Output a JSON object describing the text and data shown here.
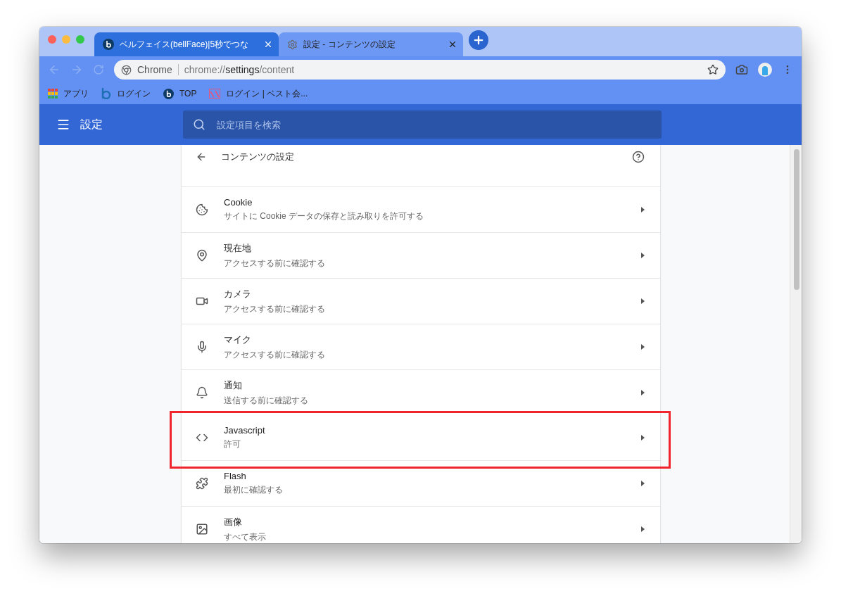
{
  "tabs": [
    {
      "title": "ベルフェイス(bellFace)|5秒でつな",
      "selected": false
    },
    {
      "title": "設定 - コンテンツの設定",
      "selected": true
    }
  ],
  "address_bar": {
    "origin_label": "Chrome",
    "url_prefix": "chrome://",
    "url_host": "settings",
    "url_path": "/content"
  },
  "bookmarks": [
    {
      "label": "アプリ"
    },
    {
      "label": "ログイン"
    },
    {
      "label": "TOP"
    },
    {
      "label": "ログイン | ベスト会..."
    }
  ],
  "header": {
    "title": "設定",
    "search_placeholder": "設定項目を検索"
  },
  "page": {
    "title": "コンテンツの設定"
  },
  "items": [
    {
      "title": "Cookie",
      "subtitle": "サイトに Cookie データの保存と読み取りを許可する",
      "highlighted": false
    },
    {
      "title": "現在地",
      "subtitle": "アクセスする前に確認する",
      "highlighted": false
    },
    {
      "title": "カメラ",
      "subtitle": "アクセスする前に確認する",
      "highlighted": false
    },
    {
      "title": "マイク",
      "subtitle": "アクセスする前に確認する",
      "highlighted": false
    },
    {
      "title": "通知",
      "subtitle": "送信する前に確認する",
      "highlighted": false
    },
    {
      "title": "Javascript",
      "subtitle": "許可",
      "highlighted": true
    },
    {
      "title": "Flash",
      "subtitle": "最初に確認する",
      "highlighted": false
    },
    {
      "title": "画像",
      "subtitle": "すべて表示",
      "highlighted": false
    }
  ]
}
